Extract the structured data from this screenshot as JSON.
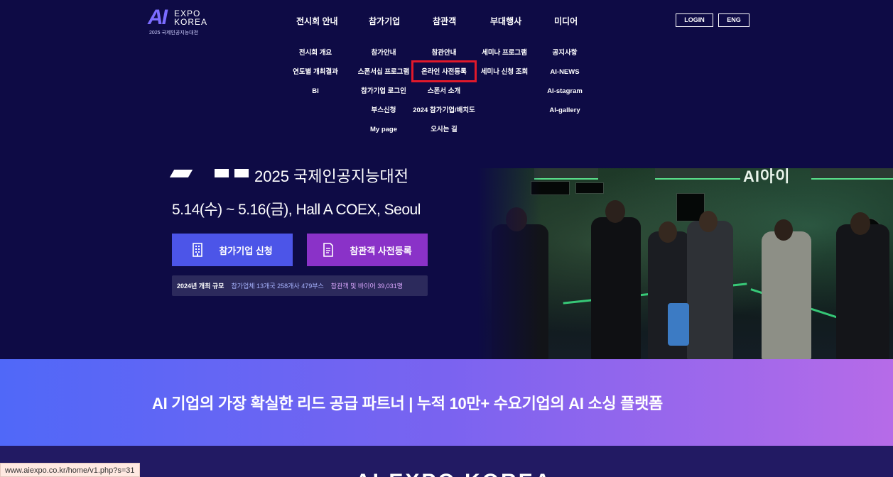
{
  "logo": {
    "mark": "AI",
    "line1": "EXPO",
    "line2": "KOREA",
    "sub": "2025 국제인공지능대전"
  },
  "nav": {
    "top": [
      "전시회 안내",
      "참가기업",
      "참관객",
      "부대행사",
      "미디어"
    ],
    "columns": [
      [
        "전시회 개요",
        "연도별 개최결과",
        "BI"
      ],
      [
        "참가안내",
        "스폰서십 프로그램",
        "참가기업 로그인",
        "부스신청",
        "My page"
      ],
      [
        "참관안내",
        "온라인 사전등록",
        "스폰서 소개",
        "2024 참가기업/배치도",
        "오시는 길"
      ],
      [
        "세미나 프로그램",
        "세미나 신청 조회"
      ],
      [
        "공지사항",
        "AI-NEWS",
        "AI-stagram",
        "AI-gallery"
      ]
    ],
    "highlighted": "온라인 사전등록"
  },
  "header_buttons": {
    "login": "LOGIN",
    "lang": "ENG"
  },
  "hero": {
    "title_partial": "2025 국제인공지능대전",
    "date_venue": "5.14(수) ~ 5.16(금), Hall A COEX, Seoul",
    "cta_exhibitor": "참가기업 신청",
    "cta_visitor": "참관객 사전등록",
    "stats": {
      "label": "2024년 개최 규모",
      "exhibitors": "참가업체 13개국 258개사 479부스",
      "visitors": "참관객 및 바이어 39,031명"
    },
    "photo_sign": "AI아이"
  },
  "banner": {
    "text": "AI 기업의 가장 확실한 리드 공급 파트너  |  누적 10만+ 수요기업의 AI 소싱 플랫폼"
  },
  "section": {
    "heading": "AI EXPO KOREA"
  },
  "status_bar": {
    "url": "www.aiexpo.co.kr/home/v1.php?s=31"
  },
  "colors": {
    "background": "#0e0b45",
    "cta_exhibitor": "#4c55e8",
    "cta_visitor": "#8a32c8",
    "highlight": "#e0192b"
  }
}
